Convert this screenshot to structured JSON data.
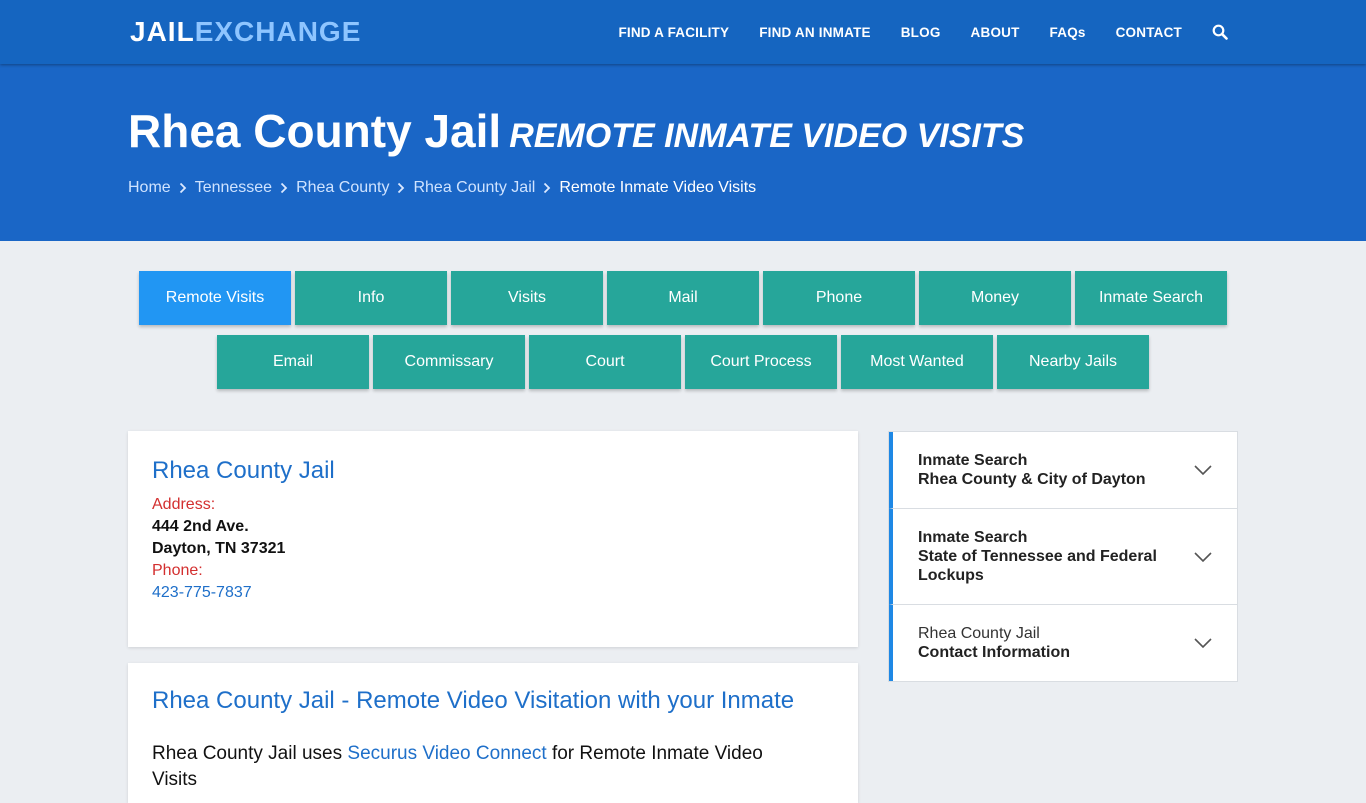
{
  "logo": {
    "part1": "JAIL",
    "part2": "EXCHANGE"
  },
  "nav": {
    "items": [
      "FIND A FACILITY",
      "FIND AN INMATE",
      "BLOG",
      "ABOUT",
      "FAQs",
      "CONTACT"
    ],
    "search_icon": "search-icon"
  },
  "hero": {
    "title": "Rhea County Jail",
    "subtitle": "REMOTE INMATE VIDEO VISITS",
    "breadcrumbs": [
      "Home",
      "Tennessee",
      "Rhea County",
      "Rhea County Jail"
    ],
    "current": "Remote Inmate Video Visits"
  },
  "tabs": {
    "row1": [
      "Remote Visits",
      "Info",
      "Visits",
      "Mail",
      "Phone",
      "Money",
      "Inmate Search"
    ],
    "row2": [
      "Email",
      "Commissary",
      "Court",
      "Court Process",
      "Most Wanted",
      "Nearby Jails"
    ],
    "active": "Remote Visits"
  },
  "facility": {
    "name": "Rhea County Jail",
    "address_label": "Address:",
    "address_line1": "444 2nd Ave.",
    "address_line2": "Dayton, TN 37321",
    "phone_label": "Phone:",
    "phone": "423-775-7837"
  },
  "article": {
    "title": "Rhea County Jail - Remote Video Visitation with your Inmate",
    "text_before": "Rhea County Jail uses ",
    "link": "Securus Video Connect",
    "text_after": " for Remote Inmate Video Visits"
  },
  "sidebar": {
    "items": [
      {
        "line1": "Inmate Search",
        "line2": "Rhea County & City of Dayton"
      },
      {
        "line1": "Inmate Search",
        "line2": "State of Tennessee and Federal Lockups"
      },
      {
        "line1": "Rhea County Jail",
        "line2": "Contact Information"
      }
    ]
  },
  "colors": {
    "nav_bg": "#1565c0",
    "hero_bg": "#1a66c6",
    "tab_bg": "#26a69a",
    "tab_active": "#2196f3",
    "link": "#1e6fc9",
    "label_red": "#d32f2f"
  }
}
